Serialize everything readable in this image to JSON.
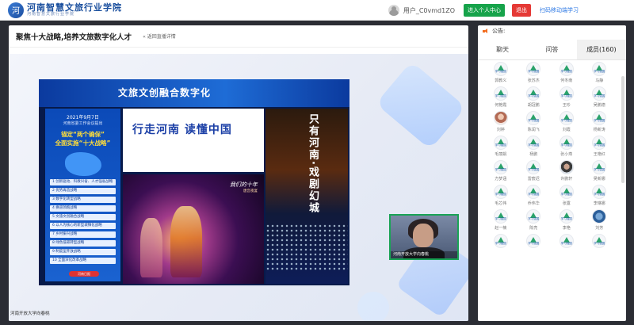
{
  "header": {
    "logo_mark": "河",
    "title": "河南智慧文旅行业学院",
    "subtitle": "河南智慧文旅行业学院",
    "username": "用户_C0vmd1ZO",
    "personal_center": "进入个人中心",
    "logout": "退出",
    "scan_study": "扫码移动端学习"
  },
  "player": {
    "course_title": "聚焦十大战略,培养文旅数字化人才",
    "back_label": "« 返回直播详情",
    "presenter_label": "河南开放大学向春桃"
  },
  "slide": {
    "title": "文旅文创融合数字化",
    "date": "2021年9月7日",
    "meeting": "河南省委工作会议提出",
    "h1": "锚定“两个确保”",
    "h2": "全面实施“十大战略”",
    "items": [
      "1 创新驱动、科教兴省、人才强省战略",
      "2 优势再造战略",
      "3 数字化转型战略",
      "4 换道领跑战略",
      "5 文旅文创融合战略",
      "6 以人为核心的新型城镇化战略",
      "7 乡村振兴战略",
      "8 绿色低碳转型战略",
      "9 制度型开放战略",
      "10 全面深化改革战略"
    ],
    "footer_badge": "河南日报",
    "banner": "行走河南 读懂中国",
    "photo_caption": "我们的十年",
    "photo_sub": "唐宫夜宴",
    "vertical_text": "只有河南·戏剧幻城"
  },
  "camera": {
    "label": "河南开放大学向春桃"
  },
  "panel": {
    "notice_label": "公告:",
    "tabs": [
      "聊天",
      "问答",
      "成员(160)"
    ],
    "members": [
      "郭教义",
      "张苏杰",
      "何冬南",
      "马静",
      "何艳霞",
      "胡冠鹏",
      "王珍",
      "吴鹏德",
      "刘婷",
      "陈润飞",
      "刘霞",
      "杨新涛",
      "毛丽娟",
      "杨鹏",
      "张小燕",
      "王艳红",
      "方梦涵",
      "雷宸迟",
      "许鹏轩",
      "吴新娜",
      "毛芯伟",
      "乔伟华",
      "张露",
      "李琳娜",
      "赵一楠",
      "陈亮",
      "李艳",
      "刘芳",
      "",
      "",
      "",
      ""
    ],
    "member_badge": "学习强国"
  }
}
